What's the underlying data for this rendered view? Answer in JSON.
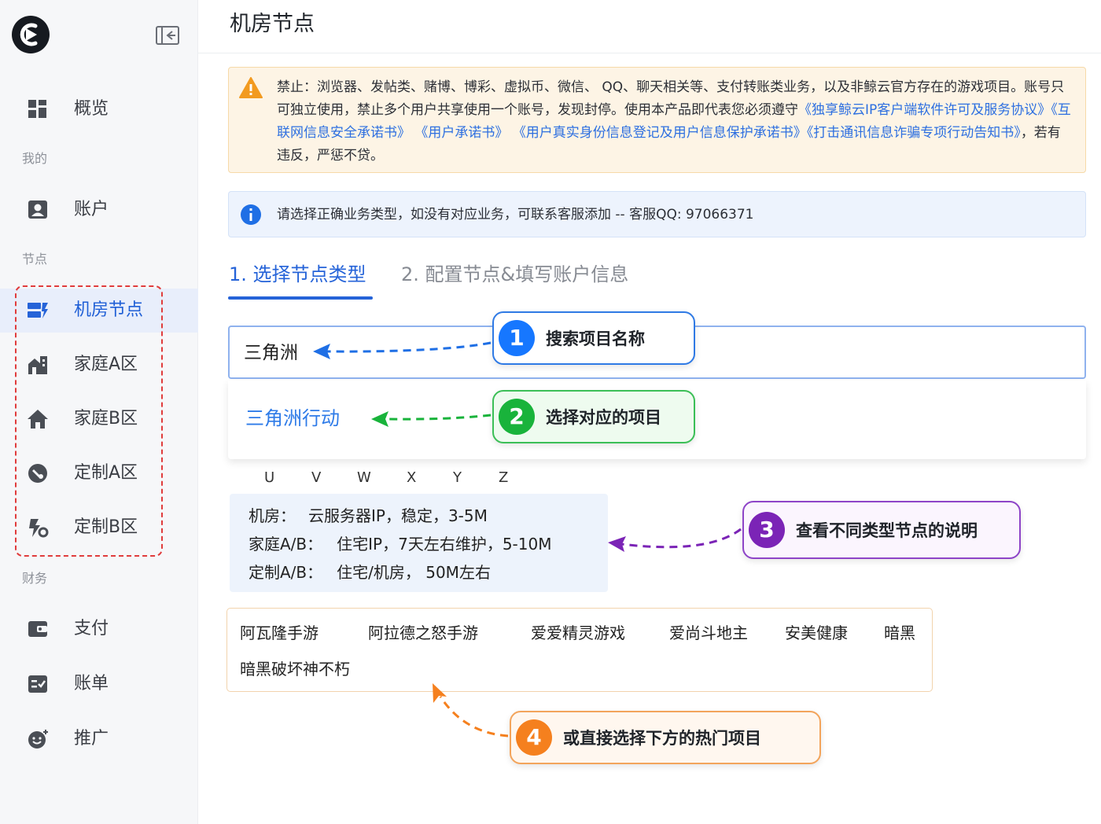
{
  "sidebar": {
    "items": [
      {
        "label": "概览",
        "icon": "dashboard-icon"
      },
      {
        "label": "账户",
        "icon": "account-icon"
      },
      {
        "label": "机房节点",
        "icon": "datacenter-icon",
        "active": true
      },
      {
        "label": "家庭A区",
        "icon": "building-icon"
      },
      {
        "label": "家庭B区",
        "icon": "home-icon"
      },
      {
        "label": "定制A区",
        "icon": "wrench-icon"
      },
      {
        "label": "定制B区",
        "icon": "custom-icon"
      },
      {
        "label": "支付",
        "icon": "wallet-icon"
      },
      {
        "label": "账单",
        "icon": "bill-icon"
      },
      {
        "label": "推广",
        "icon": "promote-icon"
      }
    ],
    "groups": {
      "mine": "我的",
      "nodes": "节点",
      "finance": "财务"
    }
  },
  "header": {
    "title": "机房节点"
  },
  "warning": {
    "text_1": "禁止：浏览器、发帖类、赌博、博彩、虚拟币、微信、 QQ、聊天相关等、支付转账类业务，以及非鲸云官方存在的游戏项目。账号只可独立使用，禁止多个用户共享使用一个账号，发现封停。使用本产品即代表您必须遵守",
    "link_1": "《独享鲸云IP客户端软件许可及服务协议》",
    "link_2": "《互联网信息安全承诺书》",
    "link_3": "《用户承诺书》",
    "link_4": "《用户真实身份信息登记及用户信息保护承诺书》",
    "link_5": "《打击通讯信息诈骗专项行动告知书》",
    "text_2": "，若有违反，严惩不贷。"
  },
  "info": {
    "text": "请选择正确业务类型，如没有对应业务，可联系客服添加 -- 客服QQ: 97066371"
  },
  "steps": {
    "step_1": "1. 选择节点类型",
    "step_2": "2. 配置节点&填写账户信息"
  },
  "search": {
    "value": "三角洲"
  },
  "dropdown": {
    "items": [
      "三角洲行动"
    ]
  },
  "letters": [
    "U",
    "V",
    "W",
    "X",
    "Y",
    "Z"
  ],
  "descriptions": [
    {
      "label": "机房：",
      "text": "云服务器IP，稳定，3-5M"
    },
    {
      "label": "家庭A/B：",
      "text": "住宅IP，7天左右维护，5-10M"
    },
    {
      "label": "定制A/B：",
      "text": "住宅/机房， 50M左右"
    }
  ],
  "hot_projects": [
    "阿瓦隆手游",
    "阿拉德之怒手游",
    "爱爱精灵游戏",
    "爱尚斗地主",
    "安美健康",
    "暗黑",
    "暗黑破坏神不朽"
  ],
  "callouts": {
    "c1": {
      "num": "1",
      "text": "搜索项目名称"
    },
    "c2": {
      "num": "2",
      "text": "选择对应的项目"
    },
    "c3": {
      "num": "3",
      "text": "查看不同类型节点的说明"
    },
    "c4": {
      "num": "4",
      "text": "或直接选择下方的热门项目"
    }
  },
  "colors": {
    "brand_blue": "#2563d8",
    "warning_bg": "#fdf4e5",
    "info_bg": "#edf3fd",
    "callout_blue": "#1677ff",
    "callout_green": "#19b33b",
    "callout_purple": "#7b24b6",
    "callout_orange": "#f5801e",
    "highlight_dash": "#e03c3c"
  }
}
